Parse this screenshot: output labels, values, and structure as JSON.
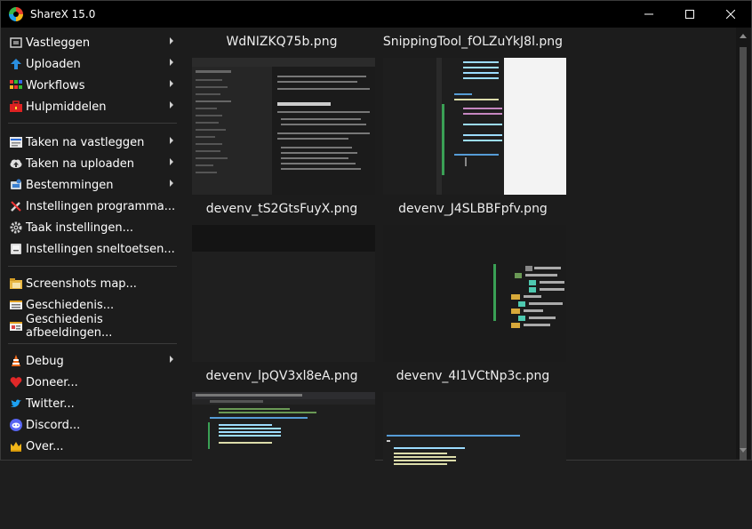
{
  "window": {
    "title": "ShareX 15.0"
  },
  "menu": [
    {
      "id": "capture",
      "label": "Vastleggen",
      "icon": "capture-icon",
      "submenu": true
    },
    {
      "id": "upload",
      "label": "Uploaden",
      "icon": "upload-icon",
      "submenu": true
    },
    {
      "id": "workflows",
      "label": "Workflows",
      "icon": "workflows-icon",
      "submenu": true
    },
    {
      "id": "tools",
      "label": "Hulpmiddelen",
      "icon": "toolbox-icon",
      "submenu": true
    },
    {
      "id": "after-capture",
      "label": "Taken na vastleggen",
      "icon": "after-capture-icon",
      "submenu": true
    },
    {
      "id": "after-upload",
      "label": "Taken na uploaden",
      "icon": "cloud-upload-icon",
      "submenu": true
    },
    {
      "id": "destinations",
      "label": "Bestemmingen",
      "icon": "destinations-icon",
      "submenu": true
    },
    {
      "id": "app-settings",
      "label": "Instellingen programma...",
      "icon": "wrench-icon",
      "submenu": false
    },
    {
      "id": "task-settings",
      "label": "Taak instellingen...",
      "icon": "gear-icon",
      "submenu": false
    },
    {
      "id": "hotkey-settings",
      "label": "Instellingen sneltoetsen...",
      "icon": "keyboard-icon",
      "submenu": false
    },
    {
      "id": "screenshots-folder",
      "label": "Screenshots map...",
      "icon": "folder-icon",
      "submenu": false
    },
    {
      "id": "history",
      "label": "Geschiedenis...",
      "icon": "history-icon",
      "submenu": false
    },
    {
      "id": "image-history",
      "label": "Geschiedenis afbeeldingen...",
      "icon": "image-history-icon",
      "submenu": false
    },
    {
      "id": "debug",
      "label": "Debug",
      "icon": "debug-cone-icon",
      "submenu": true
    },
    {
      "id": "donate",
      "label": "Doneer...",
      "icon": "heart-icon",
      "submenu": false
    },
    {
      "id": "twitter",
      "label": "Twitter...",
      "icon": "twitter-icon",
      "submenu": false
    },
    {
      "id": "discord",
      "label": "Discord...",
      "icon": "discord-icon",
      "submenu": false
    },
    {
      "id": "about",
      "label": "Over...",
      "icon": "crown-icon",
      "submenu": false
    }
  ],
  "thumbnails": [
    {
      "filename": "WdNIZKQ75b.png",
      "preview": "browser-docs-page"
    },
    {
      "filename": "SnippingTool_fOLZuYkJ8l.png",
      "preview": "code-editor"
    },
    {
      "filename": "devenv_tS2GtsFuyX.png",
      "preview": "dark-editor"
    },
    {
      "filename": "devenv_J4SLBBFpfv.png",
      "preview": "solution-explorer"
    },
    {
      "filename": "devenv_lpQV3xl8eA.png",
      "preview": "visual-studio-code"
    },
    {
      "filename": "devenv_4I1VCtNp3c.png",
      "preview": "dark-code"
    }
  ],
  "colors": {
    "background": "#1c1c1c",
    "titlebar": "#000000",
    "text": "#ffffff"
  }
}
